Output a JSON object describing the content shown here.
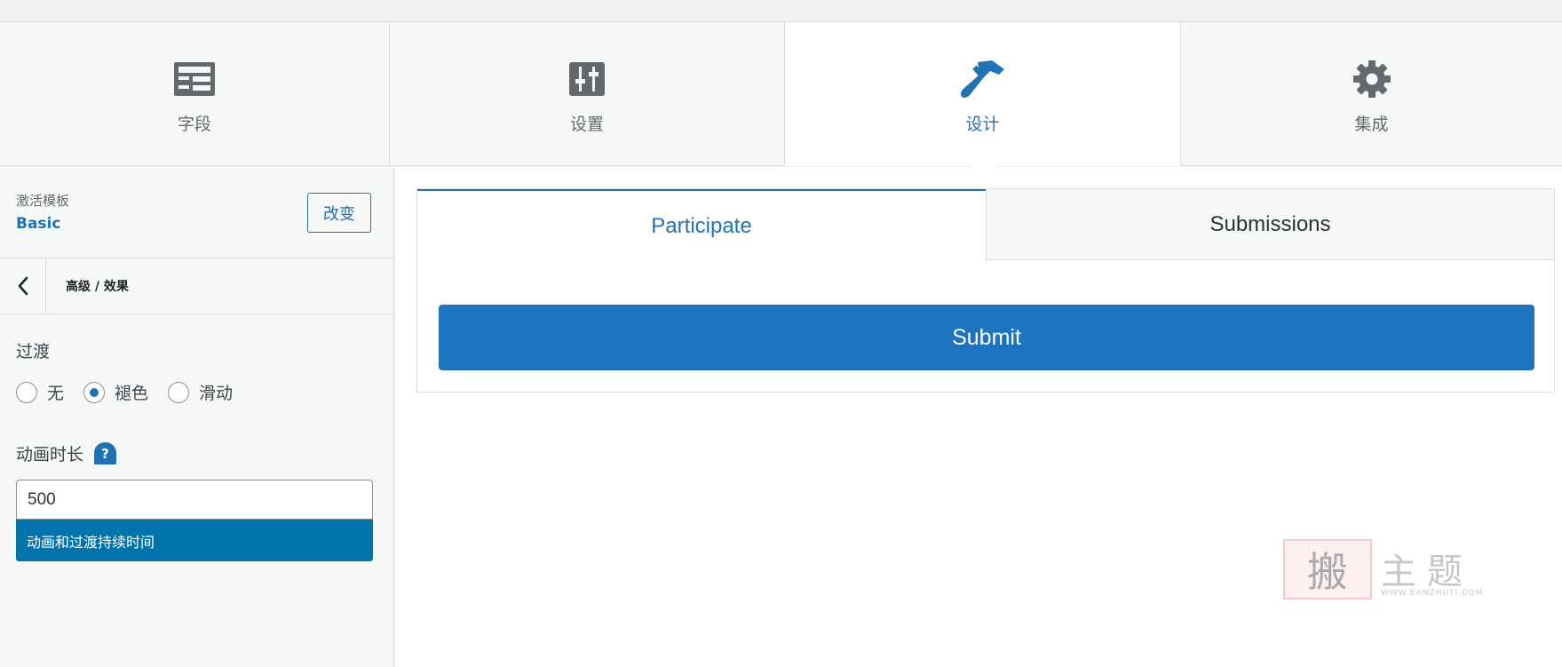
{
  "tabs": [
    {
      "label": "字段",
      "icon": "fields-icon",
      "active": false
    },
    {
      "label": "设置",
      "icon": "sliders-icon",
      "active": false
    },
    {
      "label": "设计",
      "icon": "paint-brush-icon",
      "active": true
    },
    {
      "label": "集成",
      "icon": "gear-icon",
      "active": false
    }
  ],
  "sidebar": {
    "template_caption": "激活模板",
    "template_name": "Basic",
    "change_label": "改变",
    "breadcrumb": "高级 / 效果",
    "transition": {
      "label": "过渡",
      "options": [
        "无",
        "褪色",
        "滑动"
      ],
      "selected": "褪色"
    },
    "duration": {
      "label": "动画时长",
      "help": "?",
      "value": "500",
      "tip": "动画和过渡持续时间"
    }
  },
  "preview": {
    "tab_participate": "Participate",
    "tab_submissions": "Submissions",
    "submit_label": "Submit"
  },
  "watermark": {
    "seal": "搬",
    "text": "主题",
    "url": "WWW.BANZHUTI.COM"
  },
  "colors": {
    "accent": "#2271b1",
    "submit": "#1e73be",
    "tip": "#0073aa"
  }
}
